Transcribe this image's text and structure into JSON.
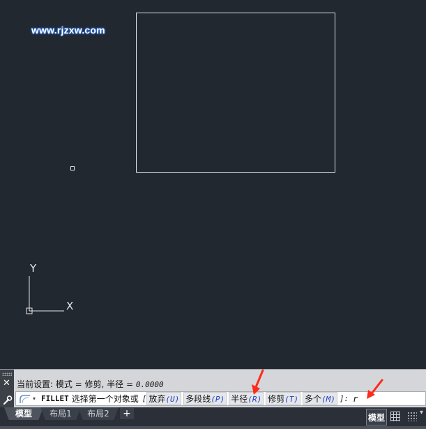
{
  "watermark": "www.rjzxw.com",
  "ucs": {
    "x_label": "X",
    "y_label": "Y"
  },
  "command": {
    "close_glyph": "✕",
    "customize_glyph": "🔧",
    "history_prefix": "当前设置: 模式 = 修剪, 半径 = ",
    "history_value": "0.0000",
    "name": "FILLET",
    "prompt": "选择第一个对象或",
    "open_bracket": "[",
    "options": [
      {
        "label": "放弃",
        "key": "(U)"
      },
      {
        "label": "多段线",
        "key": "(P)"
      },
      {
        "label": "半径",
        "key": "(R)"
      },
      {
        "label": "修剪",
        "key": "(T)"
      },
      {
        "label": "多个",
        "key": "(M)"
      }
    ],
    "close_bracket": "]:",
    "typed_value": "r",
    "caret_glyph": "▾"
  },
  "tabs": [
    {
      "label": "模型",
      "active": true
    },
    {
      "label": "布局1",
      "active": false
    },
    {
      "label": "布局2",
      "active": false
    }
  ],
  "add_tab_glyph": "+",
  "status": {
    "model_label": "模型",
    "more_glyph": "▾"
  },
  "colors": {
    "background": "#212830",
    "annotation_arrow": "#ff2a1a",
    "option_key": "#1b3fc4"
  },
  "icons": [
    "close-icon",
    "wrench-icon",
    "fillet-command-icon",
    "grid-icon",
    "snap-icon"
  ]
}
